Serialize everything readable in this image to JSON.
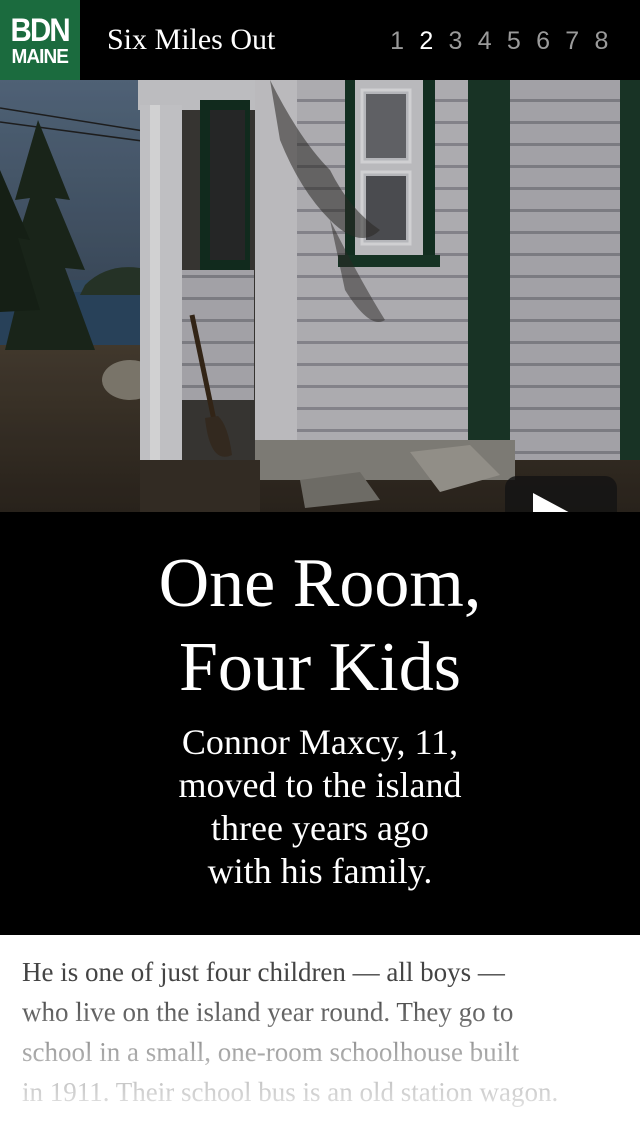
{
  "header": {
    "logo_line1": "BDN",
    "logo_line2": "MAINE",
    "site_title": "Six Miles Out",
    "pages": [
      "1",
      "2",
      "3",
      "4",
      "5",
      "6",
      "7",
      "8"
    ],
    "active_page": "2"
  },
  "hero": {
    "play_icon": "play-icon"
  },
  "story": {
    "headline_line1": "One Room,",
    "headline_line2": "Four Kids",
    "dek_lines": [
      "Connor Maxcy, 11,",
      "moved to the island",
      "three years ago",
      "with his family."
    ],
    "body_lines": [
      "He is one of just four children — all boys —",
      "who live on the island year round. They go to",
      "school in a small, one-room schoolhouse built",
      "in 1911. Their school bus is an old station wagon."
    ]
  },
  "colors": {
    "brand_green": "#1b6b3e",
    "background": "#000000",
    "body_bg": "#ffffff"
  }
}
